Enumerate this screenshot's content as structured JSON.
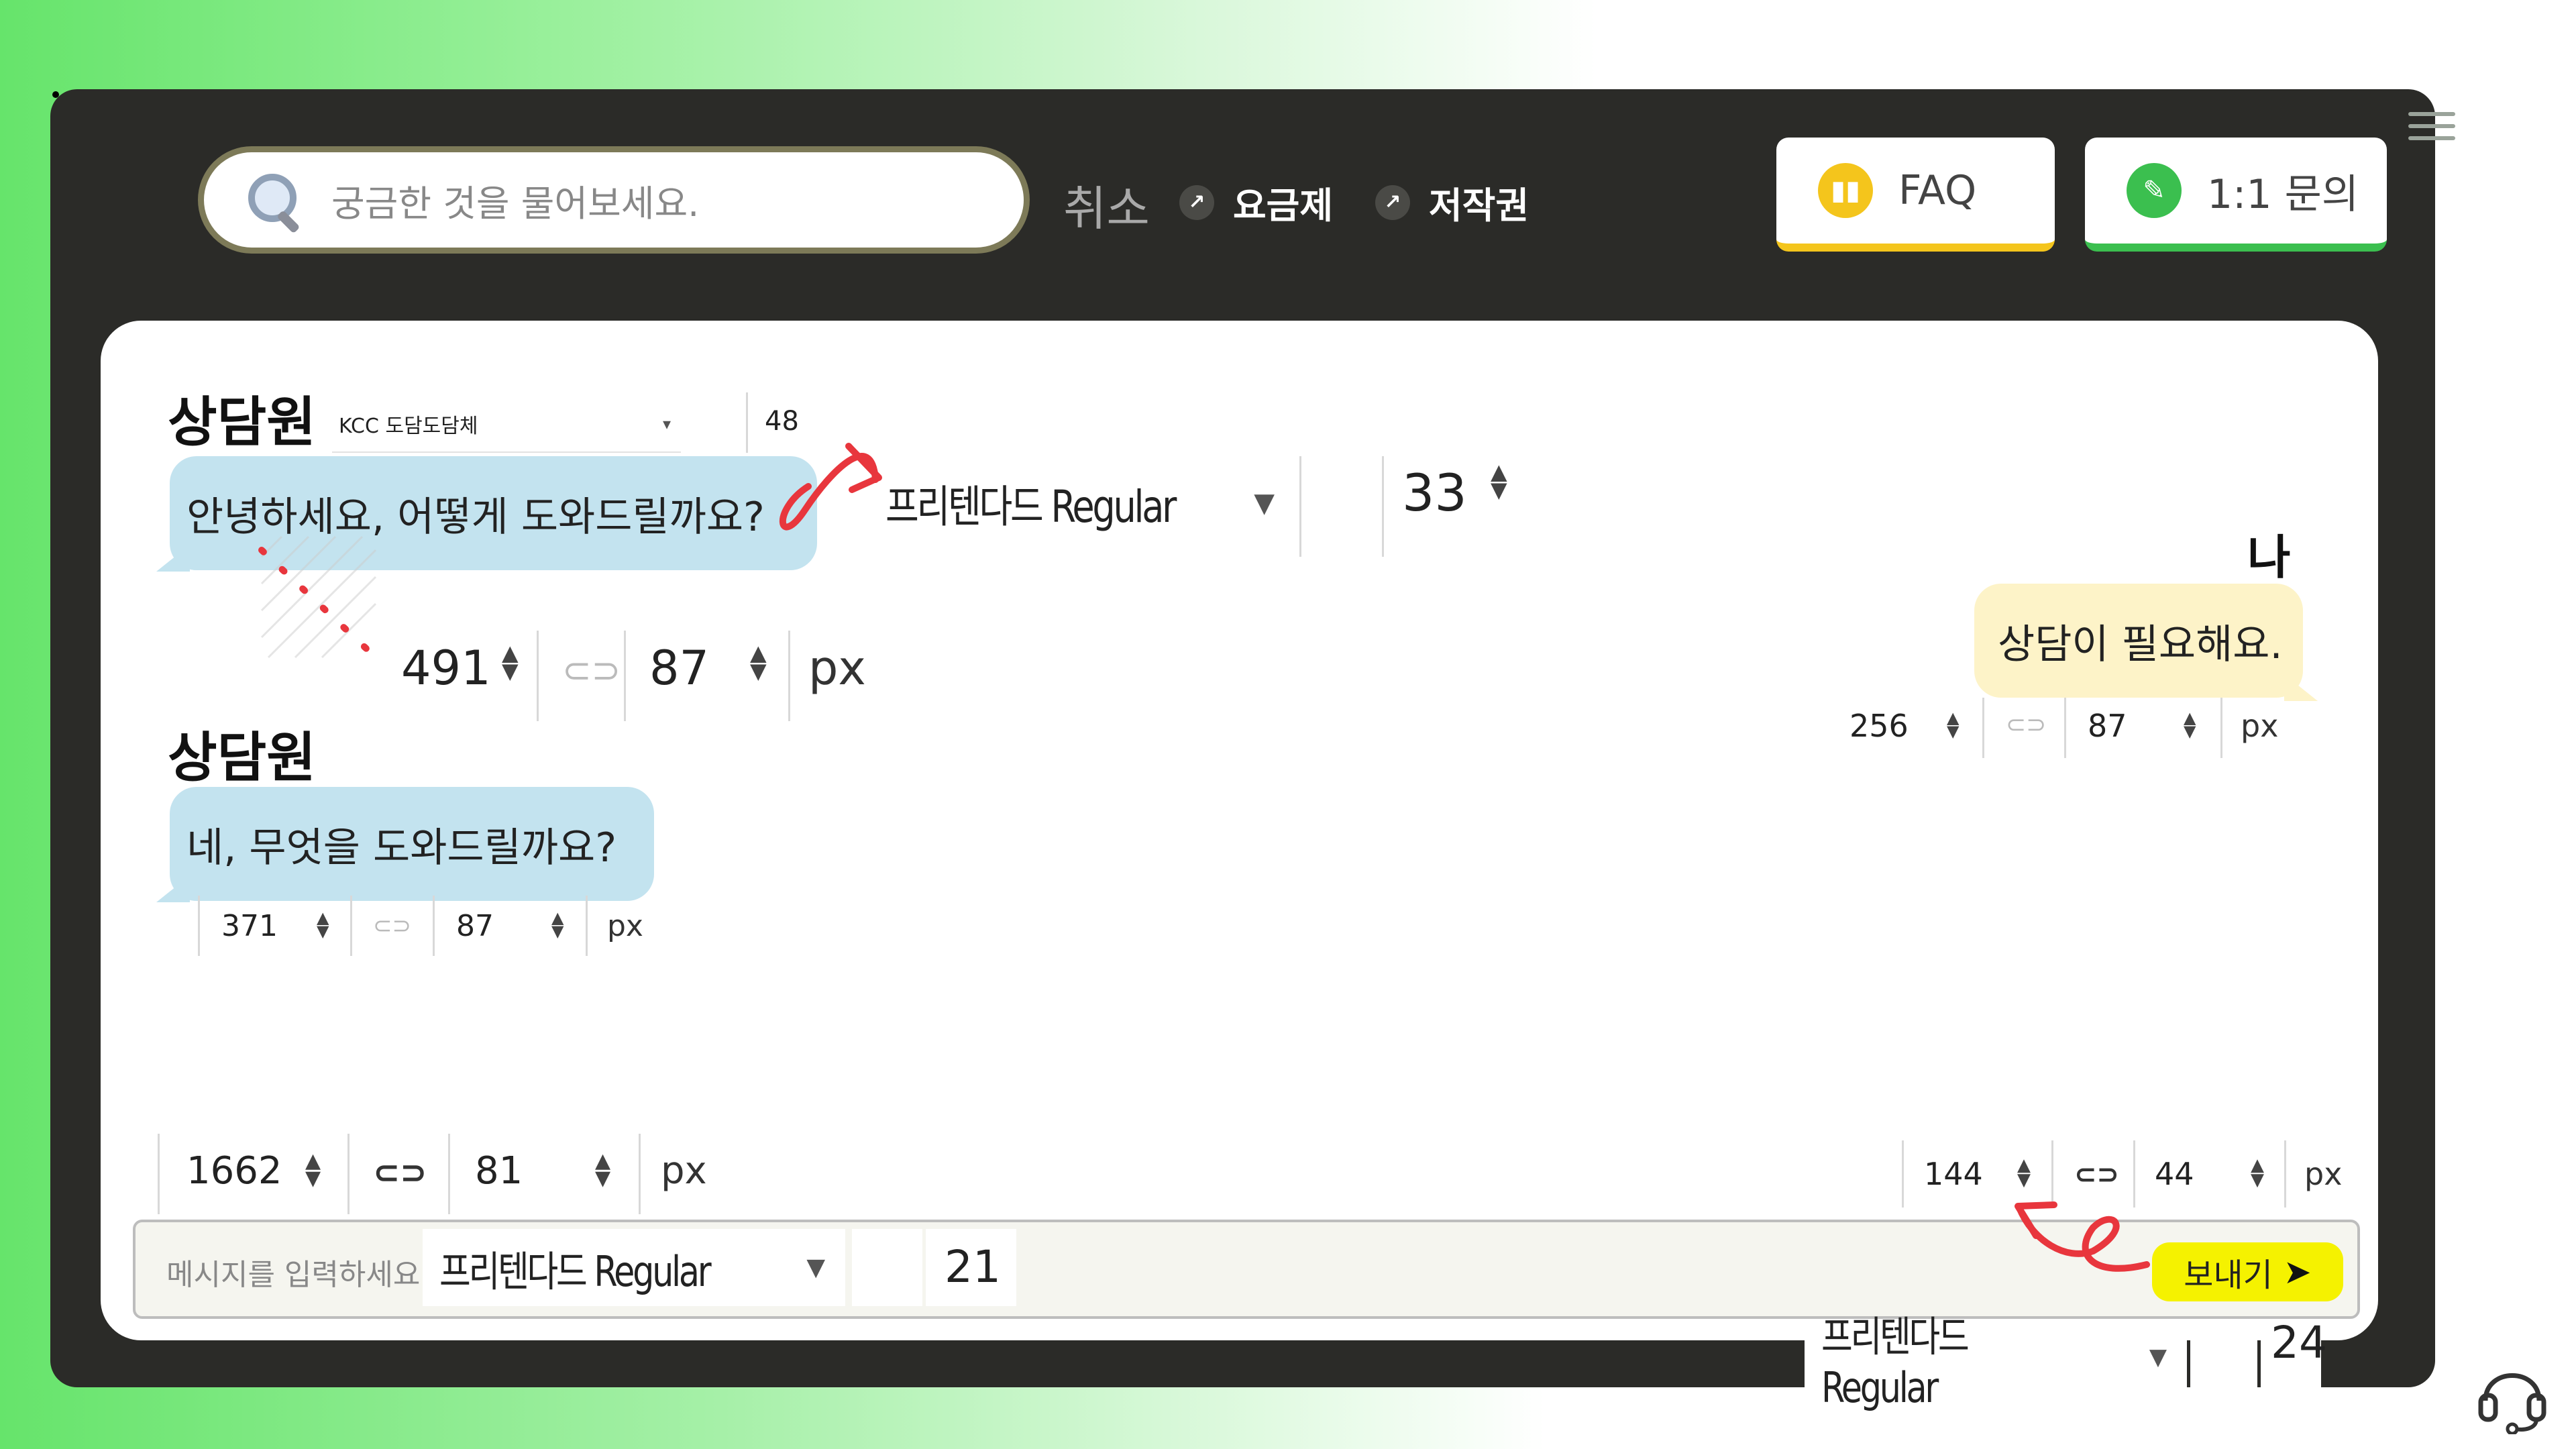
{
  "header": {
    "search_placeholder": "궁금한 것을 물어보세요.",
    "cancel_label": "취소",
    "links": [
      "요금제",
      "저작권"
    ],
    "faq_label": "FAQ",
    "inquiry_label": "1:1 문의"
  },
  "chat": {
    "counselor_label": "상담원",
    "me_label": "나",
    "messages": [
      {
        "from": "counselor",
        "text": "안녕하세요, 어떻게 도와드릴까요?"
      },
      {
        "from": "me",
        "text": "상담이 필요해요."
      },
      {
        "from": "counselor",
        "text": "네, 무엇을 도와드릴까요?"
      }
    ]
  },
  "editor": {
    "label_font": {
      "family": "KCC 도담도담체",
      "size": "48"
    },
    "bubble1_font": {
      "family": "프리텐다드 Regular",
      "size": "33"
    },
    "bubble1_size": {
      "w": "491",
      "h": "87",
      "unit": "px"
    },
    "bubble_me_size": {
      "w": "256",
      "h": "87",
      "unit": "px"
    },
    "bubble2_size": {
      "w": "371",
      "h": "87",
      "unit": "px"
    },
    "chat_area_size": {
      "w": "1662",
      "h": "81",
      "unit": "px"
    },
    "send_btn_size": {
      "w": "144",
      "h": "44",
      "unit": "px"
    },
    "input_font": {
      "family": "프리텐다드 Regular",
      "size": "21"
    },
    "send_font": {
      "family": "프리텐다드 Regular",
      "size": "24"
    }
  },
  "input": {
    "placeholder": "메시지를 입력하세요",
    "send_label": "보내기"
  },
  "colors": {
    "frame": "#2b2b28",
    "counselor_bubble": "#c3e3ef",
    "me_bubble": "#fdf3c8",
    "faq_accent": "#f4c51c",
    "inquiry_accent": "#3bbf4f",
    "send_button": "#f5f200",
    "annotation_red": "#e8363d"
  },
  "icons": [
    "search-icon",
    "arrow-up-right-icon",
    "book-icon",
    "pencil-icon",
    "link-icon",
    "paper-plane-icon",
    "headset-icon",
    "hamburger-icon"
  ]
}
